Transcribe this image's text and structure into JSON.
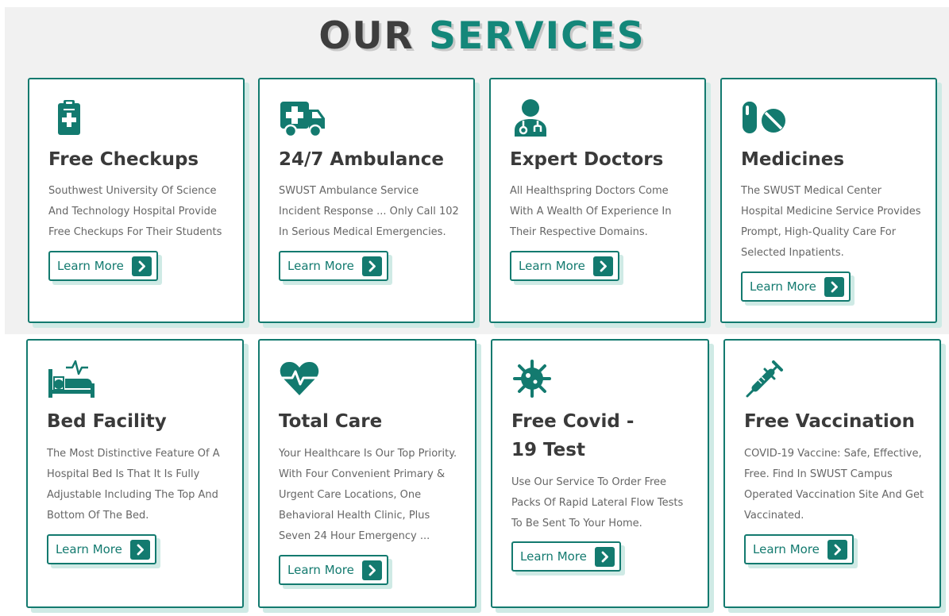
{
  "heading": {
    "word1": "OUR",
    "word2": "SERVICES"
  },
  "colors": {
    "accent": "#137a6f",
    "title": "#3a3a3a",
    "text": "#666666",
    "shadow": "#cfeae5"
  },
  "services": [
    {
      "icon": "clipboard-medical-icon",
      "title": "Free Checkups",
      "description": "Southwest University Of Science And Technology Hospital Provide Free Checkups For Their Students",
      "button": "Learn More"
    },
    {
      "icon": "ambulance-icon",
      "title": "24/7 Ambulance",
      "description": "SWUST Ambulance Service Incident Response ... Only Call 102 In Serious Medical Emergencies.",
      "button": "Learn More"
    },
    {
      "icon": "doctor-icon",
      "title": "Expert Doctors",
      "description": "All Healthspring Doctors Come With A Wealth Of Experience In Their Respective Domains.",
      "button": "Learn More"
    },
    {
      "icon": "pills-icon",
      "title": "Medicines",
      "description": "The SWUST Medical Center Hospital Medicine Service Provides Prompt, High-Quality Care For Selected Inpatients.",
      "button": "Learn More"
    },
    {
      "icon": "hospital-bed-icon",
      "title": "Bed Facility",
      "description": "The Most Distinctive Feature Of A Hospital Bed Is That It Is Fully Adjustable Including The Top And Bottom Of The Bed.",
      "button": "Learn More"
    },
    {
      "icon": "heartbeat-icon",
      "title": "Total Care",
      "description": "Your Healthcare Is Our Top Priority. With Four Convenient Primary & Urgent Care Locations, One Behavioral Health Clinic, Plus Seven 24 Hour Emergency ...",
      "button": "Learn More"
    },
    {
      "icon": "virus-icon",
      "title": "Free Covid - 19 Test",
      "description": "Use Our Service To Order Free Packs Of Rapid Lateral Flow Tests To Be Sent To Your Home.",
      "button": "Learn More"
    },
    {
      "icon": "syringe-icon",
      "title": "Free Vaccination",
      "description": "COVID-19 Vaccine: Safe, Effective, Free. Find In SWUST Campus Operated Vaccination Site And Get Vaccinated.",
      "button": "Learn More"
    }
  ]
}
